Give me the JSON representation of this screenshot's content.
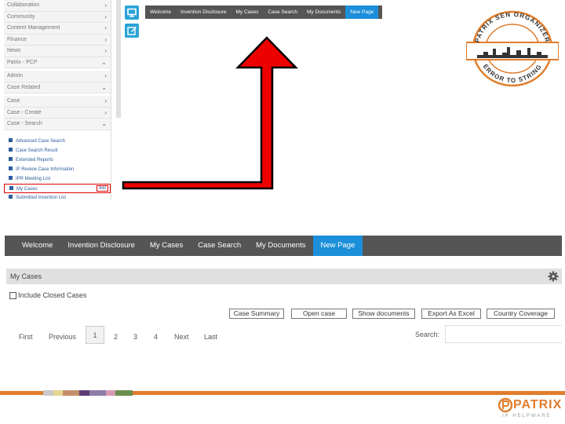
{
  "sidebar": {
    "items": [
      {
        "label": "Collaboration",
        "chevron": "›"
      },
      {
        "label": "Community",
        "chevron": "›"
      },
      {
        "label": "Content Management",
        "chevron": "›"
      },
      {
        "label": "Finance",
        "chevron": "›"
      },
      {
        "label": "News",
        "chevron": "›"
      },
      {
        "label": "Patrix - PCP",
        "chevron": "⌄"
      },
      {
        "label": "Admin",
        "chevron": "›"
      },
      {
        "label": "Case Related",
        "chevron": "⌄"
      },
      {
        "label": "Case",
        "chevron": "›"
      },
      {
        "label": "Case - Create",
        "chevron": "›"
      },
      {
        "label": "Case - Search",
        "chevron": "⌄"
      }
    ],
    "sub_items": [
      "Advanced Case Search",
      "Case Search Result",
      "Extended Reports",
      "IP Review Case Information",
      "IPR Meeting List",
      "My Cases",
      "Submitted Invention List"
    ],
    "selected_badge": "Add"
  },
  "mini_nav": {
    "tabs": [
      "Welcome",
      "Invention Disclosure",
      "My Cases",
      "Case Search",
      "My Documents",
      "New Page"
    ],
    "active_index": 5
  },
  "stamp": {
    "top_text": "PATRIX SEN ORGANIZER",
    "bottom_text": "ERROR TO STRING"
  },
  "big_nav": {
    "tabs": [
      "Welcome",
      "Invention Disclosure",
      "My Cases",
      "Case Search",
      "My Documents",
      "New Page"
    ],
    "active_index": 5
  },
  "panel": {
    "title": "My Cases",
    "include_closed_label": "Include Closed Cases",
    "buttons": [
      "Case Summary",
      "Open case",
      "Show documents",
      "Export As Excel",
      "Country Coverage"
    ],
    "pager": {
      "first": "First",
      "previous": "Previous",
      "pages": [
        "1",
        "2",
        "3",
        "4"
      ],
      "next": "Next",
      "last": "Last",
      "current": "1"
    },
    "search_label": "Search:",
    "search_value": ""
  },
  "footer": {
    "swatch_colors": [
      "#c9c9c9",
      "#e7d592",
      "#c58e6b",
      "#5d3d73",
      "#8d7ca6",
      "#d79ab3",
      "#6b8e4e"
    ],
    "accent_color": "#e07d2c",
    "logo_text": "PATRIX",
    "logo_sub": "IP HELPWARE"
  }
}
